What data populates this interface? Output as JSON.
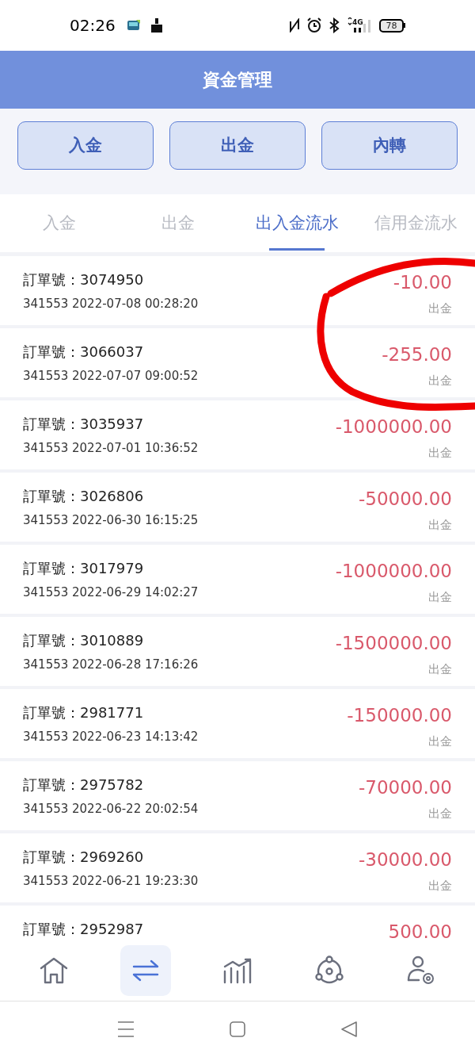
{
  "status_bar": {
    "time": "02:26",
    "battery": "78",
    "network": "4G"
  },
  "header": {
    "title": "資金管理"
  },
  "actions": [
    "入金",
    "出金",
    "內轉"
  ],
  "tabs": [
    {
      "label": "入金",
      "selected": false
    },
    {
      "label": "出金",
      "selected": false
    },
    {
      "label": "出入金流水",
      "selected": true
    },
    {
      "label": "信用金流水",
      "selected": false
    }
  ],
  "records": [
    {
      "order": "訂單號：3074950",
      "detail": "341553 2022-07-08 00:28:20",
      "amount": "-10.00",
      "type": "出金"
    },
    {
      "order": "訂單號：3066037",
      "detail": "341553 2022-07-07 09:00:52",
      "amount": "-255.00",
      "type": "出金"
    },
    {
      "order": "訂單號：3035937",
      "detail": "341553 2022-07-01 10:36:52",
      "amount": "-1000000.00",
      "type": "出金"
    },
    {
      "order": "訂單號：3026806",
      "detail": "341553 2022-06-30 16:15:25",
      "amount": "-50000.00",
      "type": "出金"
    },
    {
      "order": "訂單號：3017979",
      "detail": "341553 2022-06-29 14:02:27",
      "amount": "-1000000.00",
      "type": "出金"
    },
    {
      "order": "訂單號：3010889",
      "detail": "341553 2022-06-28 17:16:26",
      "amount": "-1500000.00",
      "type": "出金"
    },
    {
      "order": "訂單號：2981771",
      "detail": "341553 2022-06-23 14:13:42",
      "amount": "-150000.00",
      "type": "出金"
    },
    {
      "order": "訂單號：2975782",
      "detail": "341553 2022-06-22 20:02:54",
      "amount": "-70000.00",
      "type": "出金"
    },
    {
      "order": "訂單號：2969260",
      "detail": "341553 2022-06-21 19:23:30",
      "amount": "-30000.00",
      "type": "出金"
    },
    {
      "order": "訂單號：2952987",
      "amount": "500.00"
    }
  ],
  "bottom_nav": [
    {
      "kind": "home",
      "selected": false
    },
    {
      "kind": "transfer",
      "selected": true
    },
    {
      "kind": "chart",
      "selected": false
    },
    {
      "kind": "network",
      "selected": false
    },
    {
      "kind": "user-settings",
      "selected": false
    }
  ]
}
